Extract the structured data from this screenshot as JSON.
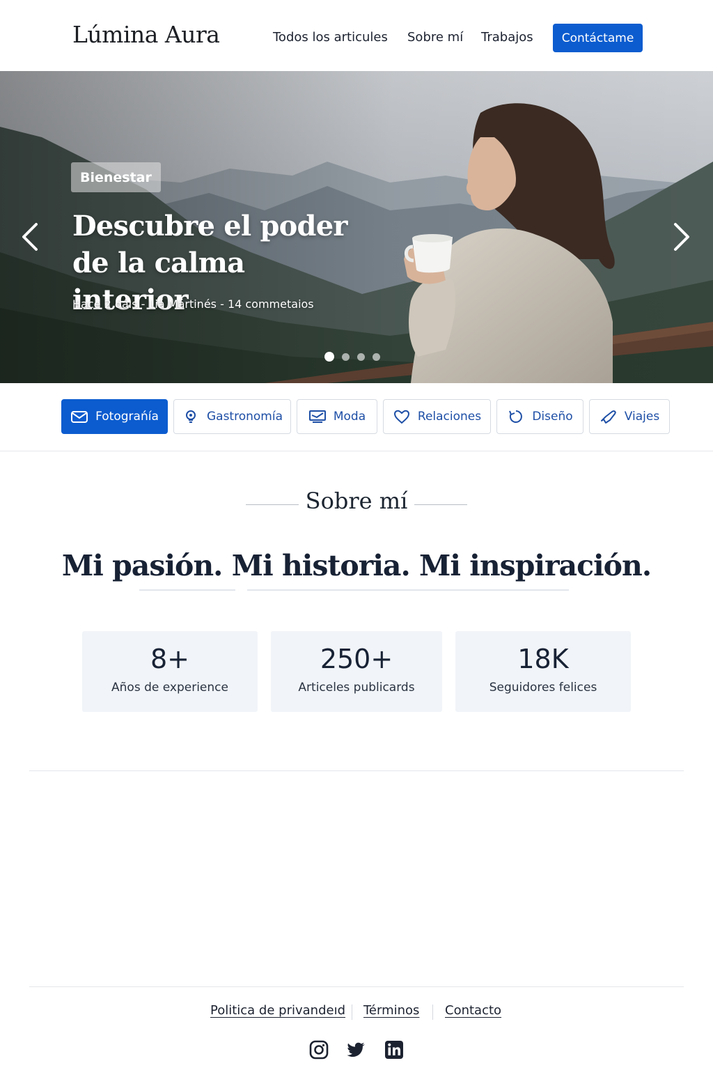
{
  "header": {
    "logo": "Lúmina Aura",
    "nav": [
      "Todos los articules",
      "Sobre mí",
      "Trabajos"
    ],
    "cta": "Contáctame"
  },
  "hero": {
    "tag": "Bienestar",
    "title": "Descubre el poder de la calma interior",
    "meta": "Hace 2 dáıs  -  Liá Mártinés  -  14 commetaios",
    "slides_total": 4,
    "active_slide": 1,
    "prev_icon": "chevron-left-icon",
    "next_icon": "chevron-right-icon"
  },
  "categories": [
    {
      "label": "Fotograńía",
      "icon": "envelope-icon",
      "active": true
    },
    {
      "label": "Gastronomía",
      "icon": "lightbulb-icon",
      "active": false
    },
    {
      "label": "Moda",
      "icon": "screen-icon",
      "active": false
    },
    {
      "label": "Relaciones",
      "icon": "heart-icon",
      "active": false
    },
    {
      "label": "Diseño",
      "icon": "refresh-icon",
      "active": false
    },
    {
      "label": "Viajes",
      "icon": "plane-icon",
      "active": false
    }
  ],
  "about": {
    "label": "Sobre mí",
    "heading": "Mi pasión. Mi historia. Mi inspiración.",
    "stats": [
      {
        "value": "8+",
        "label": "Años de experience"
      },
      {
        "value": "250+",
        "label": "Articeles publicards"
      },
      {
        "value": "18K",
        "label": "Seguidores felices"
      }
    ]
  },
  "footer": {
    "links": [
      "Politica de privandeıd",
      "Términos",
      "Contacto"
    ],
    "social": [
      "instagram-icon",
      "twitter-icon",
      "linkedin-icon"
    ]
  },
  "colors": {
    "accent": "#0c5ccf",
    "text": "#1a2433",
    "stat_bg": "#f1f4f8"
  }
}
